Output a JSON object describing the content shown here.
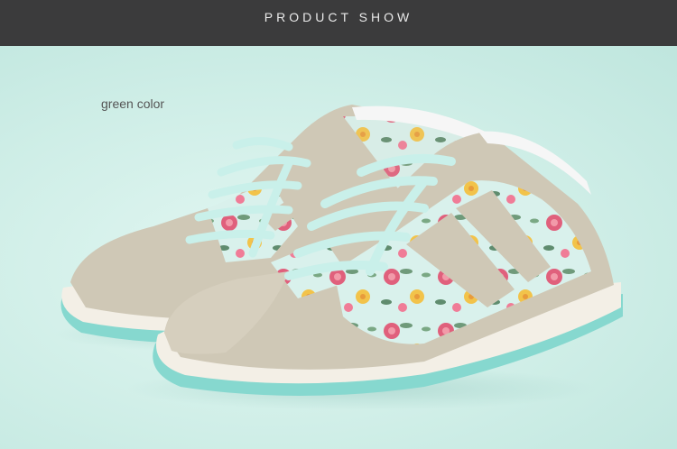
{
  "banner": {
    "title": "PRODUCT SHOW"
  },
  "product": {
    "color_label": "green color",
    "colors": {
      "banner_bg": "#3b3b3c",
      "background": "#cdeee6",
      "suede": "#cfc8b6",
      "sole_accent": "#86d8cf",
      "laces": "#c9f0ea",
      "floral_base": "#d7efe9",
      "rose": "#e0607c",
      "yellow_flower": "#f2c34a"
    }
  }
}
